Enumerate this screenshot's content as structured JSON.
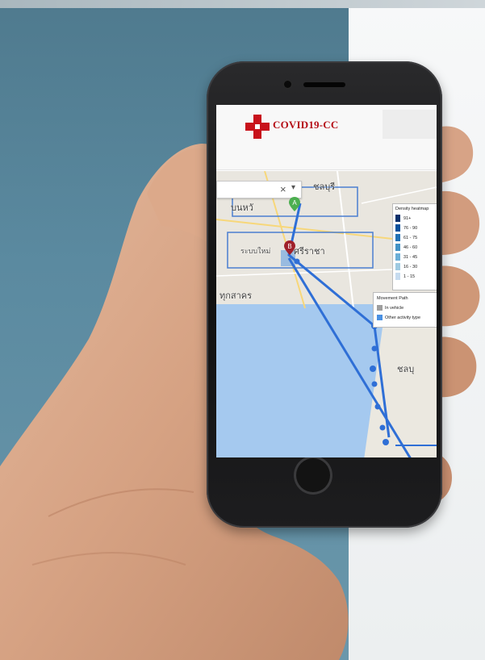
{
  "app": {
    "title": "COVID19-CC"
  },
  "map": {
    "search_clear": "×",
    "search_caret": "▾",
    "place_labels": [
      "ชลบุรี",
      "บนหวั",
      "ระบบใหม่",
      "ศรีราชา",
      "ทุกสาคร",
      "ชลบุ"
    ],
    "markers": {
      "start": "A",
      "end": "B"
    }
  },
  "density_legend": {
    "title": "Density heatmap",
    "items": [
      {
        "label": "91+",
        "color": "#08306b"
      },
      {
        "label": "76 - 90",
        "color": "#08519c"
      },
      {
        "label": "61 - 75",
        "color": "#2171b5"
      },
      {
        "label": "46 - 60",
        "color": "#4292c6"
      },
      {
        "label": "31 - 45",
        "color": "#6baed6"
      },
      {
        "label": "16 - 30",
        "color": "#9ecae1"
      },
      {
        "label": "1 - 15",
        "color": "#c6dbef"
      }
    ]
  },
  "movement_legend": {
    "title": "Movement Path",
    "items": [
      {
        "label": "In vehicle",
        "color": "#9e9e9e"
      },
      {
        "label": "Other activity type",
        "color": "#4a90e2"
      }
    ]
  },
  "colors": {
    "brand_red": "#c8121b",
    "path_blue": "#2f6fd6",
    "sea": "#a5c9ef",
    "bg_teal": "#5b8aa0"
  }
}
